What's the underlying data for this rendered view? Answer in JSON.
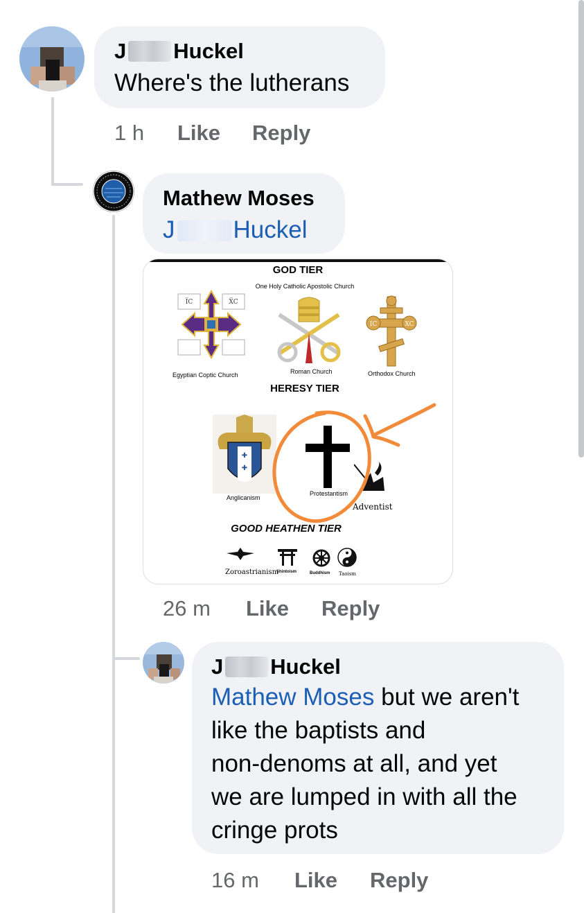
{
  "comment1": {
    "name_prefix": "J",
    "name_suffix": "Huckel",
    "text": "Where's the lutherans",
    "time": "1 h",
    "like": "Like",
    "reply": "Reply"
  },
  "comment2": {
    "name": "Mathew Moses",
    "mention_prefix": "J",
    "mention_suffix": "Huckel",
    "time": "26 m",
    "like": "Like",
    "reply": "Reply",
    "avatar_text_top": "EXPOSING FRIENDS",
    "avatar_text_bottom": "TO EXTREMIST CONTENT",
    "image": {
      "god_tier": "GOD TIER",
      "god_subtitle": "One Holy Catholic Apostolic Church",
      "coptic": "Egyptian Coptic Church",
      "roman": "Roman Church",
      "orthodox": "Orthodox Church",
      "heresy_tier": "HERESY TIER",
      "anglicanism": "Anglicanism",
      "protestantism": "Protestantism",
      "adventist": "Adventist",
      "good_heathen_tier": "GOOD HEATHEN TIER",
      "zoroastrianism": "Zoroastrianism",
      "shintoism": "Shintoism",
      "buddhism": "Buddhism",
      "taoism": "Taoism",
      "coptic_ic": "I̅C",
      "coptic_xc": "X̅C",
      "orthodox_ic": "IC",
      "orthodox_xc": "XC"
    }
  },
  "comment3": {
    "name_prefix": "J",
    "name_suffix": "Huckel",
    "mention": "Mathew Moses",
    "lines": [
      " but we aren't",
      "like the baptists and",
      "non-denoms at all, and yet",
      "we are lumped in with all the",
      "cringe prots"
    ],
    "time": "16 m",
    "like": "Like",
    "reply": "Reply"
  },
  "colors": {
    "bubble": "#f0f2f5",
    "mention": "#1b5fb5",
    "meta": "#65676b",
    "annotation": "#f28a3a"
  }
}
